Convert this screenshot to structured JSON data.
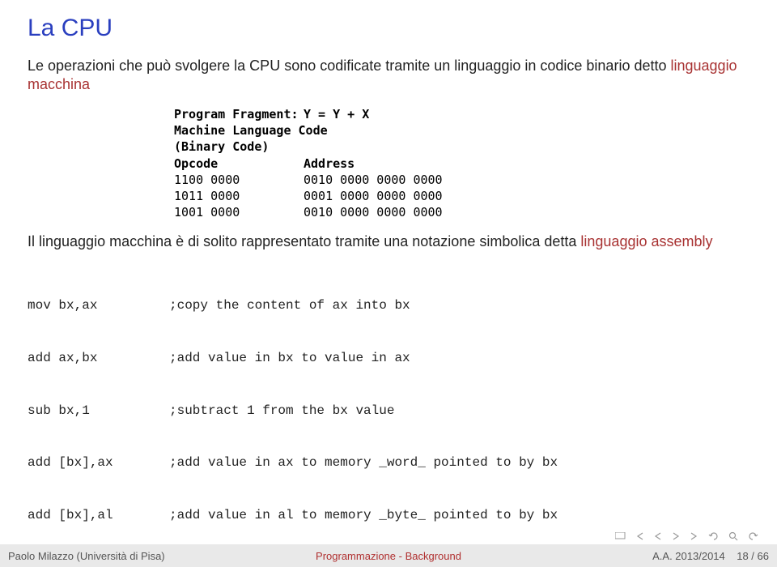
{
  "title": "La CPU",
  "para1_a": "Le operazioni che può svolgere la CPU sono codificate tramite un linguaggio in codice binario detto ",
  "para1_hl": "linguaggio macchina",
  "codeimg": {
    "header_left": "Program Fragment:",
    "header_right": "Y = Y + X",
    "line2": "Machine Language Code",
    "line3": "(Binary Code)",
    "th1": "Opcode",
    "th2": "Address",
    "rows": [
      {
        "opcode": "1100 0000",
        "address": "0010 0000 0000 0000"
      },
      {
        "opcode": "1011 0000",
        "address": "0001 0000 0000 0000"
      },
      {
        "opcode": "1001 0000",
        "address": "0010 0000 0000 0000"
      }
    ]
  },
  "para2_a": "Il linguaggio macchina è di solito rappresentato tramite una notazione simbolica detta ",
  "para2_hl": "linguaggio assembly",
  "asm": [
    {
      "instr": "mov bx,ax",
      "comment": ";copy the content of ax into bx"
    },
    {
      "instr": "add ax,bx",
      "comment": ";add value in bx to value in ax"
    },
    {
      "instr": "sub bx,1",
      "comment": ";subtract 1 from the bx value"
    },
    {
      "instr": "add [bx],ax",
      "comment": ";add value in ax to memory _word_ pointed to by bx"
    },
    {
      "instr": "add [bx],al",
      "comment": ";add value in al to memory _byte_ pointed to by bx"
    }
  ],
  "footer": {
    "left": "Paolo Milazzo (Università di Pisa)",
    "center": "Programmazione - Background",
    "right": "A.A. 2013/2014",
    "page": "18 / 66"
  }
}
